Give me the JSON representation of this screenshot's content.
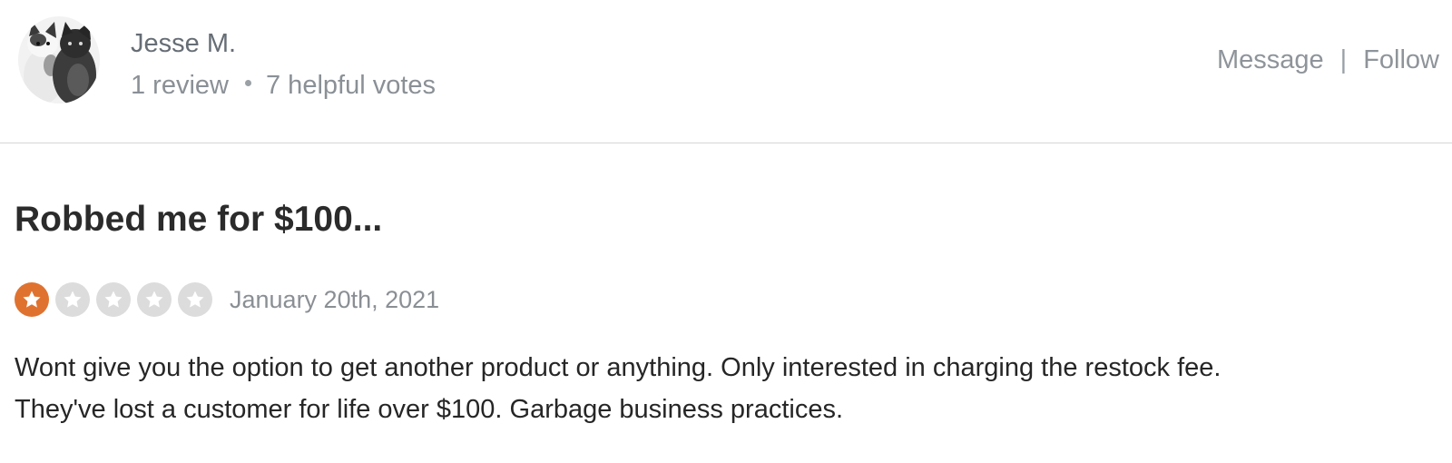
{
  "reviewer": {
    "name": "Jesse M.",
    "review_count": "1 review",
    "helpful_votes": "7 helpful votes"
  },
  "actions": {
    "message_label": "Message",
    "separator": "|",
    "follow_label": "Follow"
  },
  "review": {
    "title": "Robbed me for $100...",
    "rating": 1,
    "rating_max": 5,
    "date": "January 20th, 2021",
    "text_line_1": "Wont give you the option to get another product or anything. Only interested in charging the restock fee.",
    "text_line_2": "They've lost a customer for life over $100. Garbage business practices."
  },
  "colors": {
    "star_filled": "#e0722f",
    "star_empty": "#dcdcdc",
    "divider": "#d6d6d6"
  },
  "icons": {
    "avatar": "avatar-cats-photo",
    "star": "star-icon"
  }
}
